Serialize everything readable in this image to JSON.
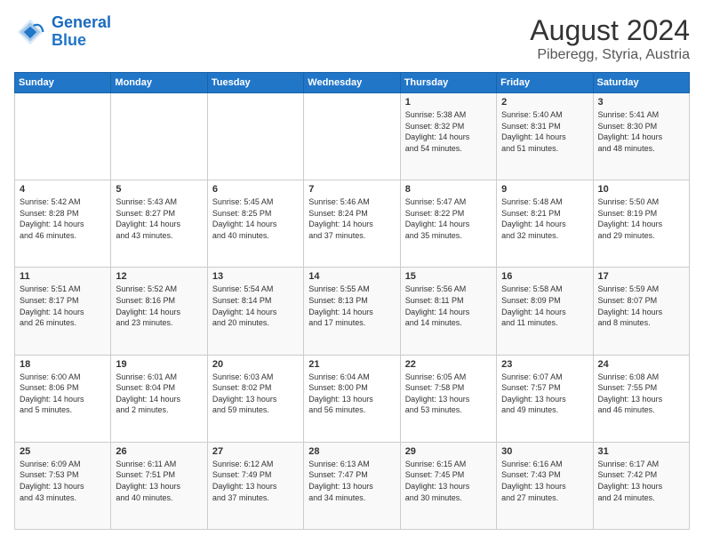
{
  "logo": {
    "line1": "General",
    "line2": "Blue"
  },
  "title": "August 2024",
  "subtitle": "Piberegg, Styria, Austria",
  "header_days": [
    "Sunday",
    "Monday",
    "Tuesday",
    "Wednesday",
    "Thursday",
    "Friday",
    "Saturday"
  ],
  "weeks": [
    [
      {
        "day": "",
        "info": ""
      },
      {
        "day": "",
        "info": ""
      },
      {
        "day": "",
        "info": ""
      },
      {
        "day": "",
        "info": ""
      },
      {
        "day": "1",
        "info": "Sunrise: 5:38 AM\nSunset: 8:32 PM\nDaylight: 14 hours\nand 54 minutes."
      },
      {
        "day": "2",
        "info": "Sunrise: 5:40 AM\nSunset: 8:31 PM\nDaylight: 14 hours\nand 51 minutes."
      },
      {
        "day": "3",
        "info": "Sunrise: 5:41 AM\nSunset: 8:30 PM\nDaylight: 14 hours\nand 48 minutes."
      }
    ],
    [
      {
        "day": "4",
        "info": "Sunrise: 5:42 AM\nSunset: 8:28 PM\nDaylight: 14 hours\nand 46 minutes."
      },
      {
        "day": "5",
        "info": "Sunrise: 5:43 AM\nSunset: 8:27 PM\nDaylight: 14 hours\nand 43 minutes."
      },
      {
        "day": "6",
        "info": "Sunrise: 5:45 AM\nSunset: 8:25 PM\nDaylight: 14 hours\nand 40 minutes."
      },
      {
        "day": "7",
        "info": "Sunrise: 5:46 AM\nSunset: 8:24 PM\nDaylight: 14 hours\nand 37 minutes."
      },
      {
        "day": "8",
        "info": "Sunrise: 5:47 AM\nSunset: 8:22 PM\nDaylight: 14 hours\nand 35 minutes."
      },
      {
        "day": "9",
        "info": "Sunrise: 5:48 AM\nSunset: 8:21 PM\nDaylight: 14 hours\nand 32 minutes."
      },
      {
        "day": "10",
        "info": "Sunrise: 5:50 AM\nSunset: 8:19 PM\nDaylight: 14 hours\nand 29 minutes."
      }
    ],
    [
      {
        "day": "11",
        "info": "Sunrise: 5:51 AM\nSunset: 8:17 PM\nDaylight: 14 hours\nand 26 minutes."
      },
      {
        "day": "12",
        "info": "Sunrise: 5:52 AM\nSunset: 8:16 PM\nDaylight: 14 hours\nand 23 minutes."
      },
      {
        "day": "13",
        "info": "Sunrise: 5:54 AM\nSunset: 8:14 PM\nDaylight: 14 hours\nand 20 minutes."
      },
      {
        "day": "14",
        "info": "Sunrise: 5:55 AM\nSunset: 8:13 PM\nDaylight: 14 hours\nand 17 minutes."
      },
      {
        "day": "15",
        "info": "Sunrise: 5:56 AM\nSunset: 8:11 PM\nDaylight: 14 hours\nand 14 minutes."
      },
      {
        "day": "16",
        "info": "Sunrise: 5:58 AM\nSunset: 8:09 PM\nDaylight: 14 hours\nand 11 minutes."
      },
      {
        "day": "17",
        "info": "Sunrise: 5:59 AM\nSunset: 8:07 PM\nDaylight: 14 hours\nand 8 minutes."
      }
    ],
    [
      {
        "day": "18",
        "info": "Sunrise: 6:00 AM\nSunset: 8:06 PM\nDaylight: 14 hours\nand 5 minutes."
      },
      {
        "day": "19",
        "info": "Sunrise: 6:01 AM\nSunset: 8:04 PM\nDaylight: 14 hours\nand 2 minutes."
      },
      {
        "day": "20",
        "info": "Sunrise: 6:03 AM\nSunset: 8:02 PM\nDaylight: 13 hours\nand 59 minutes."
      },
      {
        "day": "21",
        "info": "Sunrise: 6:04 AM\nSunset: 8:00 PM\nDaylight: 13 hours\nand 56 minutes."
      },
      {
        "day": "22",
        "info": "Sunrise: 6:05 AM\nSunset: 7:58 PM\nDaylight: 13 hours\nand 53 minutes."
      },
      {
        "day": "23",
        "info": "Sunrise: 6:07 AM\nSunset: 7:57 PM\nDaylight: 13 hours\nand 49 minutes."
      },
      {
        "day": "24",
        "info": "Sunrise: 6:08 AM\nSunset: 7:55 PM\nDaylight: 13 hours\nand 46 minutes."
      }
    ],
    [
      {
        "day": "25",
        "info": "Sunrise: 6:09 AM\nSunset: 7:53 PM\nDaylight: 13 hours\nand 43 minutes."
      },
      {
        "day": "26",
        "info": "Sunrise: 6:11 AM\nSunset: 7:51 PM\nDaylight: 13 hours\nand 40 minutes."
      },
      {
        "day": "27",
        "info": "Sunrise: 6:12 AM\nSunset: 7:49 PM\nDaylight: 13 hours\nand 37 minutes."
      },
      {
        "day": "28",
        "info": "Sunrise: 6:13 AM\nSunset: 7:47 PM\nDaylight: 13 hours\nand 34 minutes."
      },
      {
        "day": "29",
        "info": "Sunrise: 6:15 AM\nSunset: 7:45 PM\nDaylight: 13 hours\nand 30 minutes."
      },
      {
        "day": "30",
        "info": "Sunrise: 6:16 AM\nSunset: 7:43 PM\nDaylight: 13 hours\nand 27 minutes."
      },
      {
        "day": "31",
        "info": "Sunrise: 6:17 AM\nSunset: 7:42 PM\nDaylight: 13 hours\nand 24 minutes."
      }
    ]
  ]
}
